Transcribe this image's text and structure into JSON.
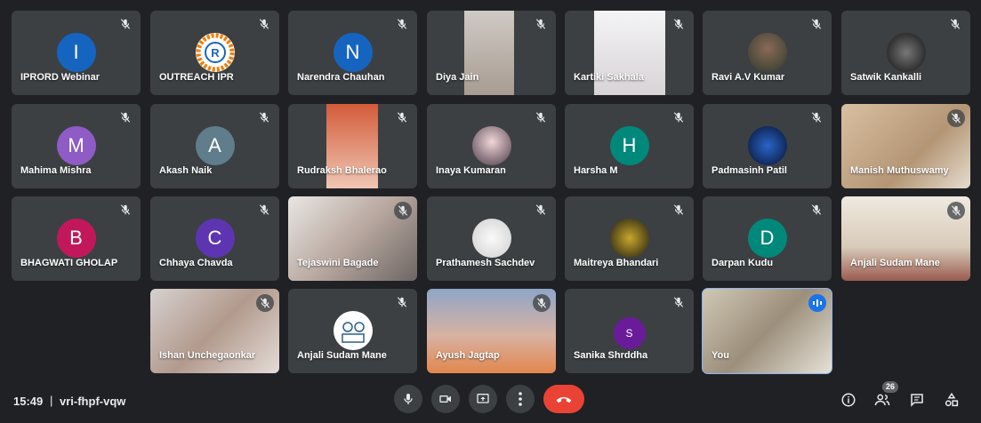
{
  "participants": [
    {
      "name": "IPRORD Webinar",
      "kind": "letter",
      "letter": "I",
      "color": "#1565c0"
    },
    {
      "name": "OUTREACH IPR",
      "kind": "logo-ipr"
    },
    {
      "name": "Narendra Chauhan",
      "kind": "letter",
      "letter": "N",
      "color": "#1565c0"
    },
    {
      "name": "Diya Jain",
      "kind": "video"
    },
    {
      "name": "Kartiki Sakhala",
      "kind": "video"
    },
    {
      "name": "Ravi A.V Kumar",
      "kind": "photo"
    },
    {
      "name": "Satwik Kankalli",
      "kind": "photo-wolf"
    },
    {
      "name": "Mahima Mishra",
      "kind": "letter",
      "letter": "M",
      "color": "#8e5cc4"
    },
    {
      "name": "Akash Naik",
      "kind": "letter",
      "letter": "A",
      "color": "#607d8b"
    },
    {
      "name": "Rudraksh Bhalerao",
      "kind": "video"
    },
    {
      "name": "Inaya Kumaran",
      "kind": "photo"
    },
    {
      "name": "Harsha M",
      "kind": "letter",
      "letter": "H",
      "color": "#00897b"
    },
    {
      "name": "Padmasinh Patil",
      "kind": "photo-dark"
    },
    {
      "name": "Manish Muthuswamy",
      "kind": "video-full"
    },
    {
      "name": "BHAGWATI GHOLAP",
      "kind": "letter",
      "letter": "B",
      "color": "#c2185b"
    },
    {
      "name": "Chhaya Chavda",
      "kind": "letter",
      "letter": "C",
      "color": "#5e35b1"
    },
    {
      "name": "Tejaswini Bagade",
      "kind": "video-full"
    },
    {
      "name": "Prathamesh Sachdev",
      "kind": "photo-meme"
    },
    {
      "name": "Maitreya Bhandari",
      "kind": "photo-dark"
    },
    {
      "name": "Darpan Kudu",
      "kind": "letter",
      "letter": "D",
      "color": "#00897b"
    },
    {
      "name": "Anjali Sudam Mane",
      "kind": "video-full"
    },
    {
      "name": "Ishan Unchegaonkar",
      "kind": "video-full"
    },
    {
      "name": "Anjali Sudam Mane",
      "kind": "photo-drawing"
    },
    {
      "name": "Ayush Jagtap",
      "kind": "video-full"
    },
    {
      "name": "Sanika Shrddha",
      "kind": "letter-small",
      "letter": "S",
      "color": "#6a1b9a"
    },
    {
      "name": "You",
      "kind": "video-full",
      "speaking": true
    }
  ],
  "bottom_bar": {
    "time": "15:49",
    "separator": "|",
    "meeting_code": "vri-fhpf-vqw",
    "participant_count": "26"
  },
  "controls": [
    "mic-icon",
    "camera-icon",
    "present-icon",
    "more-options-icon",
    "end-call-icon"
  ],
  "right_icons": [
    "info-icon",
    "people-icon",
    "chat-icon",
    "activities-icon"
  ],
  "colors": {
    "background": "#202124",
    "tile": "#3c4043",
    "end_call": "#ea4335",
    "accent": "#8ab4f8"
  }
}
